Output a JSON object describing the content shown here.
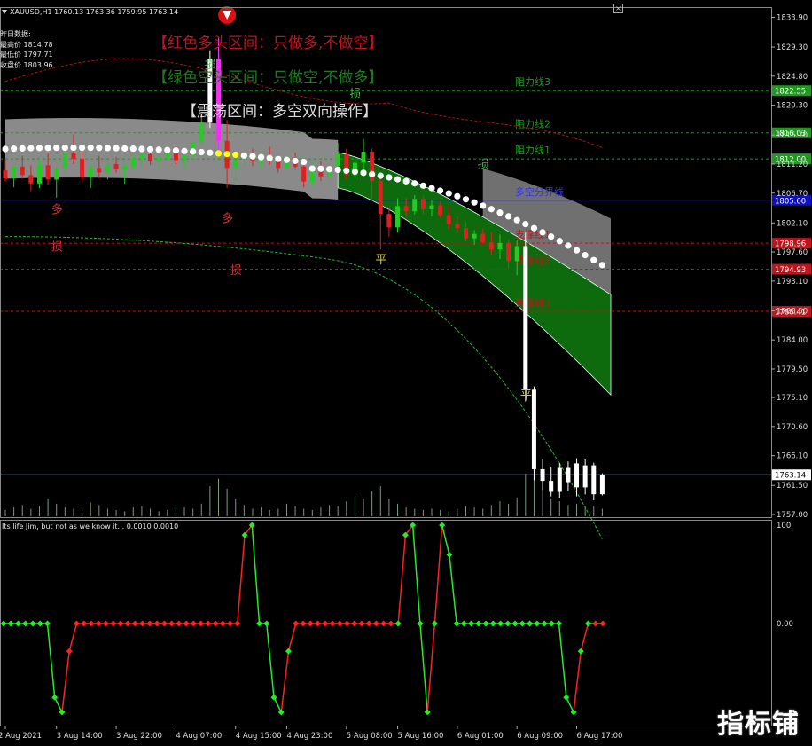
{
  "header": {
    "symbol_line": "XAUUSD,H1  1760.13 1763.36 1759.95 1763.14",
    "close_symbol": "×"
  },
  "yesterday": {
    "title": "昨日数据:",
    "high_label": "最高价 1814.78",
    "low_label": "最低价 1797.71",
    "close_label": "收盘价 1803.96"
  },
  "zones": {
    "red": "【红色多头区间：只做多,不做空】",
    "green": "【绿色空头区间：只做空,不做多】",
    "range": "【震荡区间：多空双向操作】"
  },
  "levels": [
    {
      "label": "阻力线3",
      "price": 1822.55,
      "price_text": "1822.55",
      "color": "#1e9a1e"
    },
    {
      "label": "阻力线2",
      "price": 1816.03,
      "price_text": "1816.03",
      "color": "#1e9a1e"
    },
    {
      "label": "阻力线1",
      "price": 1812.0,
      "price_text": "1812.00",
      "color": "#1e9a1e"
    },
    {
      "label": "多空分界线",
      "price": 1805.6,
      "price_text": "1805.60",
      "color": "#1010c0"
    },
    {
      "label": "支撑线1",
      "price": 1798.96,
      "price_text": "1798.96",
      "color": "#c0141c"
    },
    {
      "label": "支撑线2",
      "price": 1794.93,
      "price_text": "1794.93",
      "color": "#c0141c"
    },
    {
      "label": "支撑线3",
      "price": 1788.41,
      "price_text": "1788.41",
      "color": "#c0141c"
    }
  ],
  "current_price": {
    "price": 1763.14,
    "text": "1763.14"
  },
  "signals": [
    {
      "text": "多",
      "index": 6,
      "price": 1803.6,
      "color": "#e03030"
    },
    {
      "text": "多",
      "index": 26,
      "price": 1802.2,
      "color": "#e03030"
    },
    {
      "text": "损",
      "index": 24,
      "price": 1826.0,
      "color": "#40c040"
    },
    {
      "text": "损",
      "index": 41,
      "price": 1821.5,
      "color": "#40c040"
    },
    {
      "text": "损",
      "index": 56,
      "price": 1810.6,
      "color": "#40c040"
    },
    {
      "text": "损",
      "index": 6,
      "price": 1797.8,
      "color": "#d03030"
    },
    {
      "text": "损",
      "index": 27,
      "price": 1794.2,
      "color": "#d03030"
    },
    {
      "text": "平",
      "index": 44,
      "price": 1795.8,
      "color": "#e0d020"
    },
    {
      "text": "平",
      "index": 61,
      "price": 1774.9,
      "color": "#e0d020"
    }
  ],
  "osc_label": "Its life Jim, but not as we know it...  0.0010 0.0010",
  "watermark": "指标铺",
  "chart_data": [
    {
      "type": "candlestick",
      "title": "XAUUSD,H1",
      "ylim": [
        1756.0,
        1836.0
      ],
      "y_ticks": [
        1833.9,
        1829.3,
        1824.8,
        1820.3,
        1815.7,
        1811.2,
        1806.7,
        1802.1,
        1797.6,
        1793.1,
        1788.5,
        1784.0,
        1779.5,
        1775.1,
        1770.6,
        1766.1,
        1761.5,
        1757.0
      ],
      "x_tick_labels": [
        "2 Aug 2021",
        "3 Aug 14:00",
        "3 Aug 22:00",
        "4 Aug 07:00",
        "4 Aug 15:00",
        "4 Aug 23:00",
        "5 Aug 08:00",
        "5 Aug 16:00",
        "6 Aug 01:00",
        "6 Aug 09:00",
        "6 Aug 17:00"
      ],
      "x_tick_index": [
        0,
        6,
        13,
        20,
        27,
        33,
        40,
        46,
        53,
        60,
        67
      ],
      "candles": [
        [
          1810.2,
          1812.0,
          1808.5,
          1809.0
        ],
        [
          1809.0,
          1811.5,
          1807.6,
          1810.8
        ],
        [
          1810.8,
          1812.5,
          1808.9,
          1809.5
        ],
        [
          1809.5,
          1811.0,
          1807.0,
          1808.2
        ],
        [
          1808.2,
          1812.0,
          1807.5,
          1811.0
        ],
        [
          1811.0,
          1813.0,
          1808.0,
          1808.8
        ],
        [
          1808.8,
          1811.6,
          1806.0,
          1810.5
        ],
        [
          1810.5,
          1814.0,
          1809.8,
          1812.9
        ],
        [
          1812.9,
          1815.8,
          1811.2,
          1812.0
        ],
        [
          1812.0,
          1813.0,
          1808.5,
          1809.2
        ],
        [
          1809.2,
          1811.2,
          1807.5,
          1810.6
        ],
        [
          1810.6,
          1812.5,
          1809.0,
          1809.9
        ],
        [
          1809.9,
          1811.8,
          1808.8,
          1811.2
        ],
        [
          1811.2,
          1812.3,
          1809.9,
          1810.4
        ],
        [
          1810.4,
          1811.4,
          1808.2,
          1810.9
        ],
        [
          1810.9,
          1812.8,
          1810.2,
          1812.0
        ],
        [
          1812.0,
          1813.4,
          1810.9,
          1812.7
        ],
        [
          1812.7,
          1813.6,
          1811.1,
          1811.6
        ],
        [
          1811.6,
          1812.8,
          1810.4,
          1812.3
        ],
        [
          1812.3,
          1813.5,
          1811.8,
          1812.9
        ],
        [
          1812.9,
          1813.9,
          1811.2,
          1811.8
        ],
        [
          1811.8,
          1813.2,
          1810.2,
          1812.4
        ],
        [
          1812.4,
          1815.0,
          1811.9,
          1814.6
        ],
        [
          1814.6,
          1818.8,
          1813.9,
          1817.6
        ],
        [
          1817.6,
          1828.8,
          1816.8,
          1827.4
        ],
        [
          1827.4,
          1830.7,
          1812.5,
          1814.8
        ],
        [
          1814.8,
          1818.0,
          1807.5,
          1810.6
        ],
        [
          1810.6,
          1813.0,
          1808.4,
          1811.9
        ],
        [
          1811.9,
          1813.2,
          1810.7,
          1812.4
        ],
        [
          1812.4,
          1813.6,
          1810.9,
          1811.6
        ],
        [
          1811.6,
          1813.1,
          1810.6,
          1812.5
        ],
        [
          1812.5,
          1813.9,
          1811.1,
          1811.8
        ],
        [
          1811.8,
          1812.6,
          1809.9,
          1810.6
        ],
        [
          1810.6,
          1812.8,
          1810.0,
          1812.2
        ],
        [
          1812.2,
          1813.0,
          1810.3,
          1810.8
        ],
        [
          1810.8,
          1811.8,
          1807.6,
          1808.5
        ],
        [
          1808.5,
          1811.4,
          1807.9,
          1810.6
        ],
        [
          1810.6,
          1811.6,
          1808.6,
          1809.3
        ],
        [
          1809.3,
          1811.3,
          1808.5,
          1810.9
        ],
        [
          1810.9,
          1814.5,
          1809.8,
          1812.7
        ],
        [
          1812.7,
          1813.6,
          1808.8,
          1809.5
        ],
        [
          1809.5,
          1812.0,
          1808.9,
          1811.4
        ],
        [
          1811.4,
          1815.1,
          1810.4,
          1813.1
        ],
        [
          1813.1,
          1813.6,
          1805.8,
          1808.6
        ],
        [
          1808.6,
          1809.3,
          1798.0,
          1803.5
        ],
        [
          1803.5,
          1804.2,
          1800.0,
          1801.4
        ],
        [
          1801.4,
          1805.9,
          1800.6,
          1804.7
        ],
        [
          1804.7,
          1806.0,
          1803.2,
          1803.9
        ],
        [
          1803.9,
          1806.4,
          1803.4,
          1805.8
        ],
        [
          1805.8,
          1806.3,
          1803.5,
          1804.2
        ],
        [
          1804.2,
          1805.6,
          1803.1,
          1804.8
        ],
        [
          1804.8,
          1805.4,
          1802.9,
          1803.3
        ],
        [
          1803.3,
          1804.7,
          1801.1,
          1801.9
        ],
        [
          1801.9,
          1803.1,
          1800.5,
          1801.3
        ],
        [
          1801.3,
          1802.2,
          1799.2,
          1799.7
        ],
        [
          1799.7,
          1801.0,
          1798.7,
          1800.4
        ],
        [
          1800.4,
          1801.3,
          1798.9,
          1799.1
        ],
        [
          1799.1,
          1800.7,
          1797.1,
          1798.0
        ],
        [
          1798.0,
          1800.3,
          1796.5,
          1799.0
        ],
        [
          1799.0,
          1799.6,
          1795.0,
          1796.2
        ],
        [
          1796.2,
          1799.5,
          1794.0,
          1798.5
        ],
        [
          1798.5,
          1800.6,
          1774.5,
          1776.3
        ],
        [
          1776.3,
          1776.8,
          1762.3,
          1764.0
        ],
        [
          1764.0,
          1765.6,
          1760.8,
          1762.2
        ],
        [
          1762.2,
          1764.4,
          1759.8,
          1760.5
        ],
        [
          1760.5,
          1765.0,
          1759.6,
          1764.2
        ],
        [
          1764.2,
          1765.2,
          1760.6,
          1762.0
        ],
        [
          1764.9,
          1765.7,
          1759.8,
          1761.2
        ],
        [
          1761.2,
          1765.5,
          1760.1,
          1764.6
        ],
        [
          1764.6,
          1765.0,
          1759.2,
          1760.13
        ],
        [
          1760.13,
          1763.36,
          1759.95,
          1763.14
        ]
      ],
      "volume": [
        5,
        7,
        9,
        6,
        8,
        14,
        10,
        7,
        6,
        5,
        11,
        9,
        6,
        5,
        4,
        7,
        8,
        6,
        4,
        5,
        9,
        7,
        6,
        10,
        24,
        30,
        22,
        14,
        9,
        6,
        7,
        5,
        6,
        10,
        8,
        6,
        5,
        7,
        9,
        8,
        12,
        16,
        14,
        20,
        24,
        14,
        10,
        7,
        6,
        5,
        6,
        5,
        4,
        6,
        8,
        7,
        6,
        9,
        12,
        10,
        15,
        34,
        30,
        22,
        14,
        12,
        9,
        10,
        8,
        8,
        6
      ]
    },
    {
      "type": "line",
      "title": "Its life Jim, but not as we know it...",
      "ylim": [
        -100,
        100
      ],
      "y_ticks": [
        100,
        0.0
      ],
      "series": [
        {
          "values": [
            0,
            0,
            0,
            0,
            0,
            0,
            0,
            -75,
            -90,
            -28,
            0,
            0,
            0,
            0,
            0,
            0,
            0,
            0,
            0,
            0,
            0,
            0,
            0,
            0,
            0,
            0,
            0,
            0,
            0,
            0,
            0,
            0,
            0,
            90,
            100,
            0,
            0,
            -75,
            -90,
            -28,
            0,
            0,
            0,
            0,
            0,
            0,
            0,
            0,
            0,
            0,
            0,
            0,
            0,
            0,
            0,
            90,
            100,
            0,
            -90,
            0,
            100,
            70,
            0,
            0,
            0,
            0,
            0,
            0,
            0,
            0,
            0,
            0,
            0,
            0,
            0,
            0,
            0,
            -75,
            -90,
            -28,
            0,
            0,
            0
          ]
        }
      ]
    }
  ]
}
